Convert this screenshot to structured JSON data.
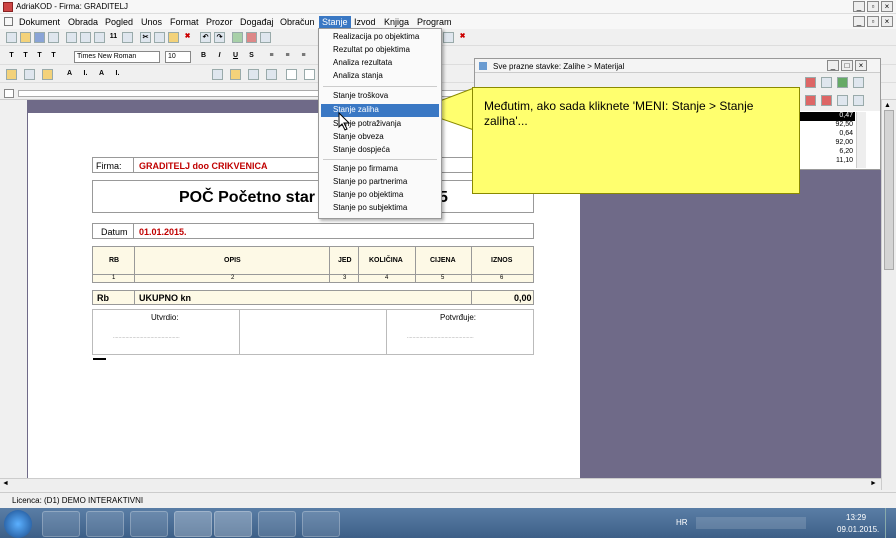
{
  "window": {
    "title": "AdriaKOD - Firma: GRADITELJ"
  },
  "menubar": [
    "Dokument",
    "Obrada",
    "Pogled",
    "Unos",
    "Format",
    "Prozor",
    "Događaj",
    "Obračun",
    "Stanje",
    "Izvod",
    "Knjiga",
    "Program"
  ],
  "format": {
    "font": "Times New Roman",
    "size": "10"
  },
  "stanje_menu": [
    "Realizacija po objektima",
    "Rezultat po objektima",
    "Analiza rezultata",
    "Analiza stanja",
    "Stanje troškova",
    "Stanje zaliha",
    "Stanje potraživanja",
    "Stanje obveza",
    "Stanje dospjeća",
    "Stanje po firmama",
    "Stanje po partnerima",
    "Stanje po objektima",
    "Stanje po subjektima"
  ],
  "subwindow": {
    "title": "Sve prazne stavke: Zalihe > Materijal",
    "values": [
      "0,47",
      "92,50",
      "0,64",
      "92,00",
      "6,20",
      "11,10"
    ]
  },
  "callout": {
    "text": "Međutim, ako sada kliknete 'MENI: Stanje > Stanje zaliha'..."
  },
  "doc": {
    "firma_label": "Firma:",
    "firma_value": "GRADITELJ doo CRIKVENICA",
    "title_left": "POČ Početno star",
    "title_right": "5",
    "datum_label": "Datum",
    "datum_value": "01.01.2015.",
    "columns": [
      "RB",
      "OPIS",
      "JED",
      "KOLIČINA",
      "CIJENA",
      "IZNOS"
    ],
    "col_numbers": [
      "1",
      "2",
      "3",
      "4",
      "5",
      "6"
    ],
    "total_rb": "Rb",
    "total_label": "UKUPNO kn",
    "total_value": "0,00",
    "sign_left": "Utvrdio:",
    "sign_right": "Potvrđuje:",
    "dots": "................................................"
  },
  "statusbar": {
    "licence": "Licenca: (D1) DEMO INTERAKTIVNI"
  },
  "taskbar": {
    "lang": "HR",
    "time": "13:29",
    "date": "09.01.2015."
  }
}
